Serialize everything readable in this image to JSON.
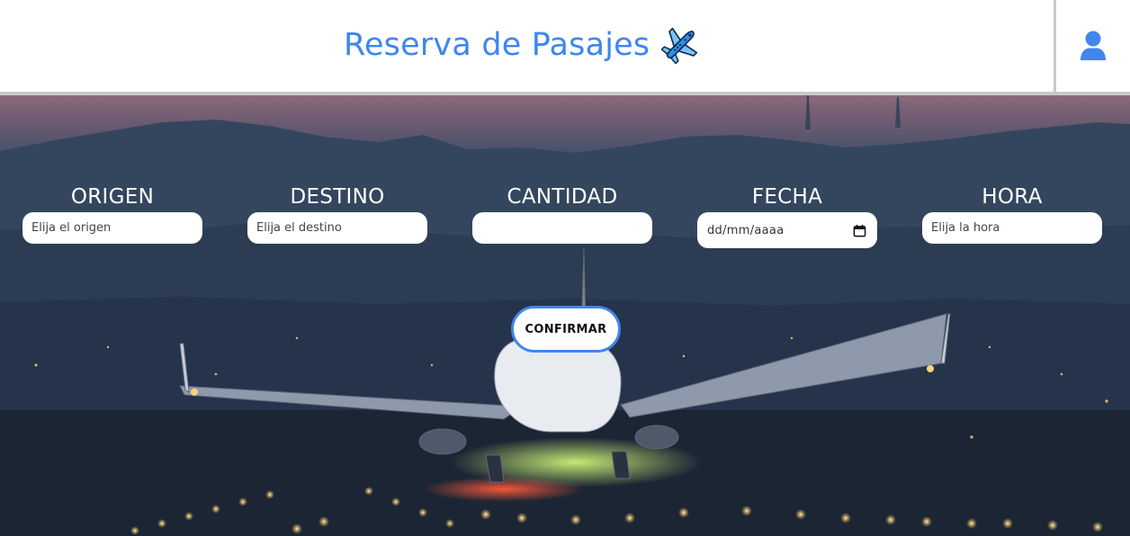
{
  "header": {
    "title": "Reserva de Pasajes",
    "title_icon": "airplane-icon",
    "user_icon": "user-icon"
  },
  "form": {
    "origin": {
      "label": "ORIGEN",
      "placeholder": "Elija el origen",
      "value": ""
    },
    "destination": {
      "label": "DESTINO",
      "placeholder": "Elija el destino",
      "value": ""
    },
    "quantity": {
      "label": "CANTIDAD",
      "placeholder": "",
      "value": ""
    },
    "date": {
      "label": "FECHA",
      "placeholder": "dd/mm/aaaa",
      "icon": "calendar-icon"
    },
    "time": {
      "label": "HORA",
      "placeholder": "Elija la hora",
      "value": ""
    },
    "confirm_label": "CONFIRMAR"
  },
  "colors": {
    "accent": "#3f86ee",
    "header_bg": "#ffffff",
    "divider": "#c9c9c9"
  }
}
